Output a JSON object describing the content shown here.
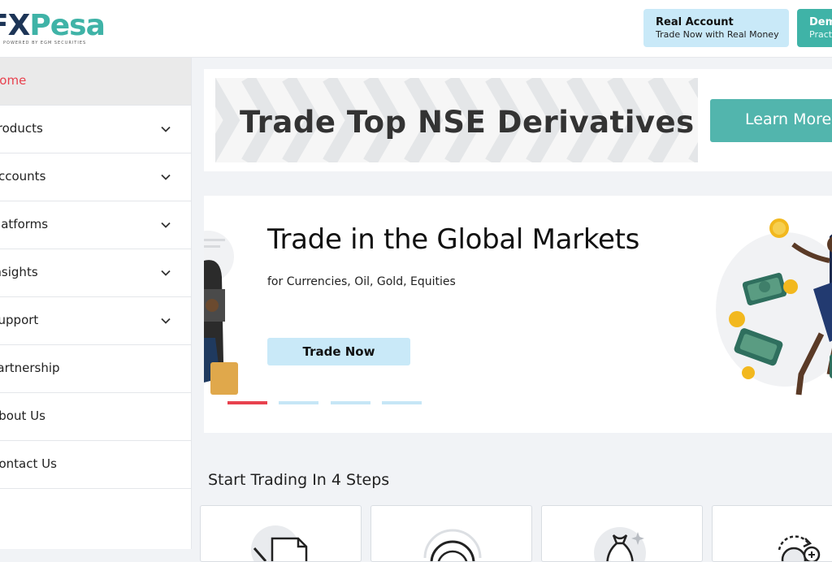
{
  "header": {
    "logo_primary": "FX",
    "logo_secondary": "Pesa",
    "logo_tagline": "POWERED BY EGM SECURITIES",
    "real_account": {
      "title": "Real Account",
      "subtitle": "Trade Now with Real Money"
    },
    "demo_account": {
      "title": "Demo",
      "subtitle": "Practice"
    }
  },
  "sidebar": {
    "items": [
      {
        "label": "Home",
        "has_chevron": false,
        "active": true
      },
      {
        "label": "Products",
        "has_chevron": true
      },
      {
        "label": "Accounts",
        "has_chevron": true
      },
      {
        "label": "Platforms",
        "has_chevron": true
      },
      {
        "label": "Insights",
        "has_chevron": true
      },
      {
        "label": "Support",
        "has_chevron": true
      },
      {
        "label": "Partnership",
        "has_chevron": false
      },
      {
        "label": "About Us",
        "has_chevron": false
      },
      {
        "label": "Contact Us",
        "has_chevron": false
      }
    ]
  },
  "banner": {
    "title": "Trade Top NSE Derivatives",
    "cta": "Learn More"
  },
  "hero": {
    "title": "Trade in the Global Markets",
    "subtitle": "for Currencies, Oil, Gold, Equities",
    "cta": "Trade Now",
    "slides_total": 4,
    "active_slide": 1
  },
  "steps": {
    "title": "Start Trading In 4 Steps",
    "icons": [
      "document-pen-icon",
      "speedometer-icon",
      "money-bag-icon",
      "coin-cycle-icon"
    ]
  },
  "colors": {
    "accent_red": "#e8414e",
    "teal": "#3fb3a7",
    "light_blue": "#c9e9f8",
    "navy": "#1d3557"
  }
}
